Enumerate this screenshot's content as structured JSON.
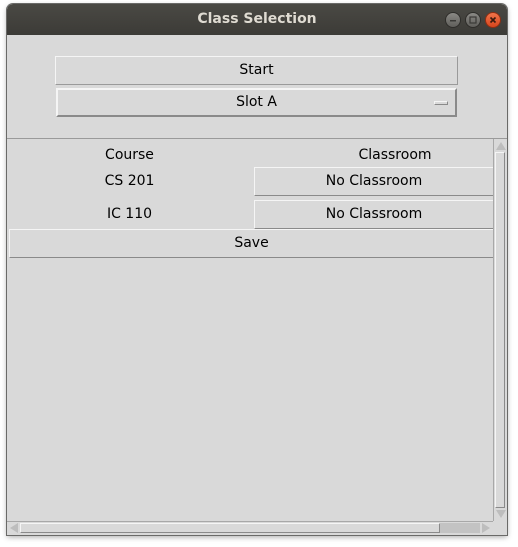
{
  "window": {
    "title": "Class Selection"
  },
  "controls": {
    "start_label": "Start",
    "slot_value": "Slot A"
  },
  "table": {
    "headers": {
      "course": "Course",
      "classroom": "Classroom"
    },
    "rows": [
      {
        "course": "CS 201",
        "classroom": "No Classroom"
      },
      {
        "course": "IC 110",
        "classroom": "No Classroom"
      }
    ],
    "save_label": "Save"
  },
  "colors": {
    "titlebar": "#3c3b37",
    "window_bg": "#d9d9d9",
    "close_button": "#e4572e"
  }
}
